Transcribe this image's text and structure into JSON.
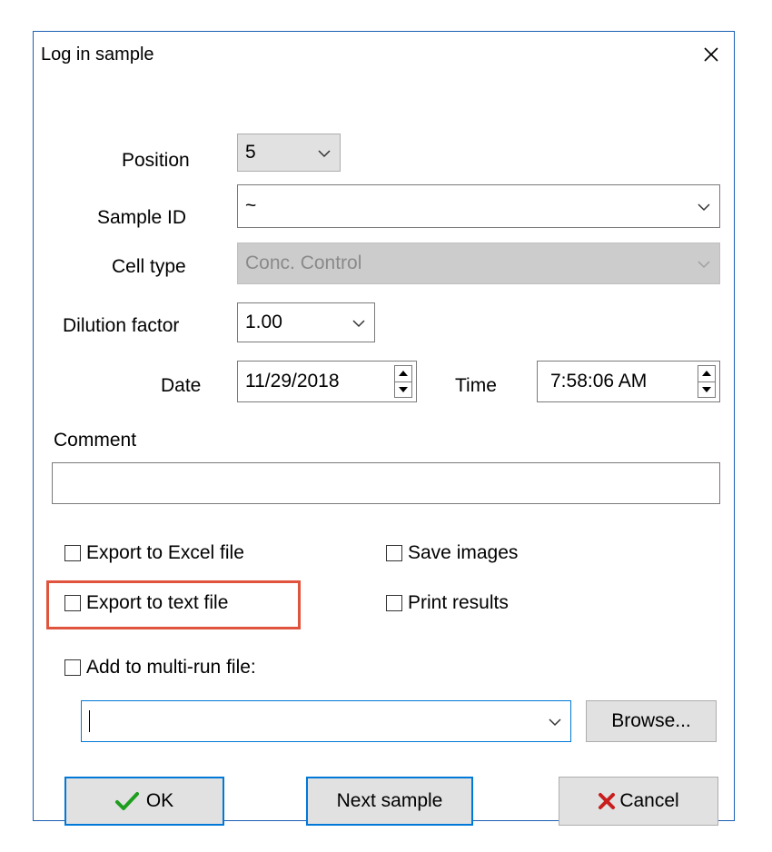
{
  "window": {
    "title": "Log in sample"
  },
  "form": {
    "position": {
      "label": "Position",
      "value": "5"
    },
    "sample_id": {
      "label": "Sample ID",
      "value": "~"
    },
    "cell_type": {
      "label": "Cell type",
      "value": "Conc. Control"
    },
    "dilution_factor": {
      "label": "Dilution factor",
      "value": "1.00"
    },
    "date": {
      "label": "Date",
      "value": "11/29/2018"
    },
    "time": {
      "label": "Time",
      "value": "7:58:06 AM"
    },
    "comment": {
      "label": "Comment",
      "value": ""
    }
  },
  "options": {
    "export_excel": {
      "label": "Export to Excel file",
      "checked": false
    },
    "save_images": {
      "label": "Save images",
      "checked": false
    },
    "export_text": {
      "label": "Export to text file",
      "checked": false
    },
    "print_results": {
      "label": "Print results",
      "checked": false
    },
    "multi_run": {
      "label": "Add to multi-run file:",
      "checked": false,
      "path": ""
    }
  },
  "buttons": {
    "browse": "Browse...",
    "ok": "OK",
    "next_sample": "Next sample",
    "cancel": "Cancel"
  },
  "colors": {
    "focus_border": "#0078d7",
    "highlight": "#e0533d",
    "ok_check": "#1e9e1e",
    "cancel_x": "#c81e1e"
  },
  "icons": {
    "close": "close-icon",
    "ok": "checkmark-icon",
    "cancel": "x-icon",
    "dropdown": "chevron-down-icon",
    "spin_up": "triangle-up-icon",
    "spin_down": "triangle-down-icon"
  }
}
